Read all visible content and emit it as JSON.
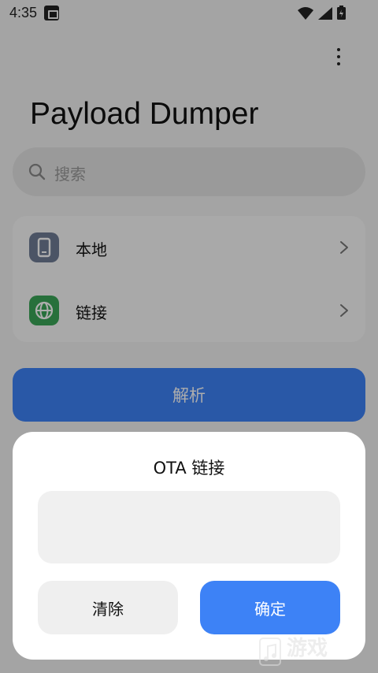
{
  "status_bar": {
    "time": "4:35"
  },
  "app": {
    "title": "Payload Dumper"
  },
  "search": {
    "placeholder": "搜索"
  },
  "source_list": {
    "items": [
      {
        "label": "本地",
        "icon": "phone-icon",
        "icon_color": "#6f7c95"
      },
      {
        "label": "链接",
        "icon": "globe-icon",
        "icon_color": "#3aa657"
      }
    ]
  },
  "parse_button": {
    "label": "解析"
  },
  "dialog": {
    "title": "OTA 链接",
    "input_value": "",
    "clear_label": "清除",
    "confirm_label": "确定"
  },
  "watermark": {
    "text": "游戏"
  },
  "colors": {
    "accent": "#3d82f6"
  }
}
